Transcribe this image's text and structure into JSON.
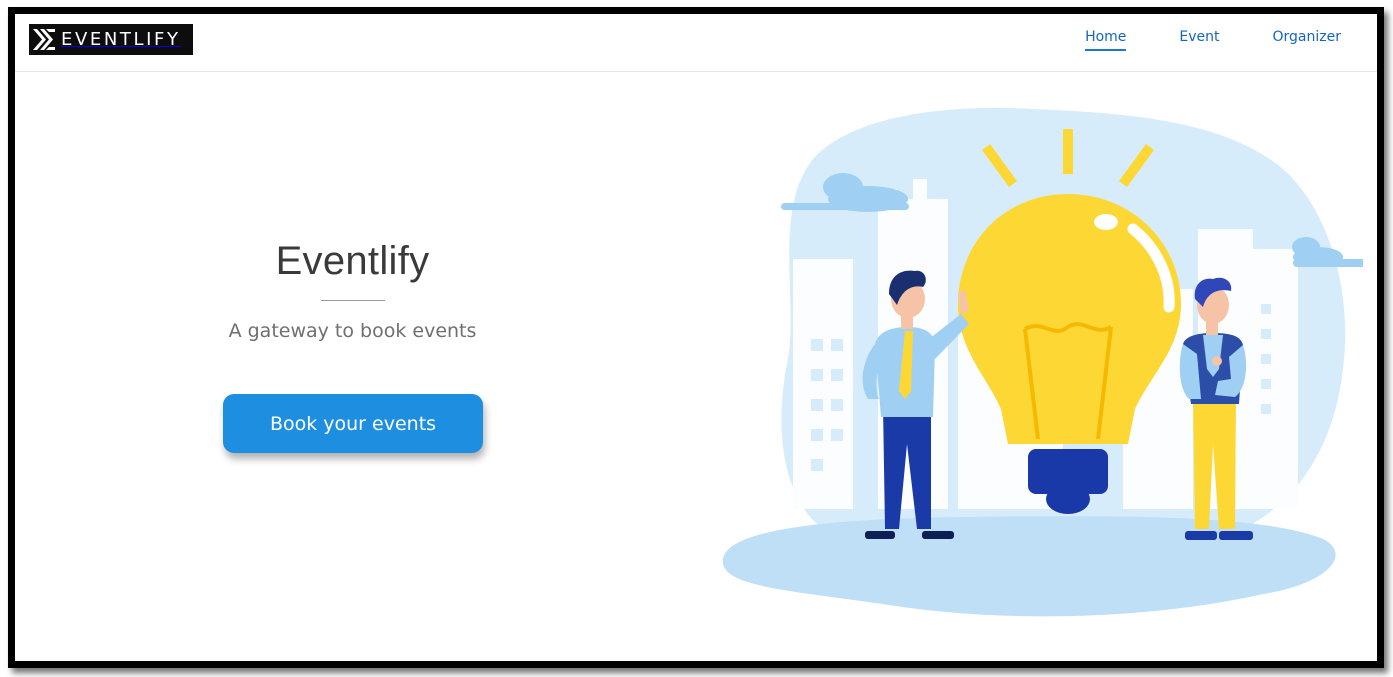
{
  "brand": {
    "logo_text": "EVENTLIFY"
  },
  "nav": {
    "items": [
      {
        "label": "Home",
        "active": true
      },
      {
        "label": "Event",
        "active": false
      },
      {
        "label": "Organizer",
        "active": false
      }
    ]
  },
  "hero": {
    "title": "Eventlify",
    "subtitle": "A gateway to book events",
    "cta_label": "Book your events"
  },
  "colors": {
    "accent": "#1e8fe0",
    "nav_link": "#1565c0",
    "bulb": "#fdd835",
    "bulb_base": "#1a39a8",
    "background_blob": "#d6ecfb"
  },
  "illustration": {
    "icon": "lightbulb-idea-illustration"
  }
}
